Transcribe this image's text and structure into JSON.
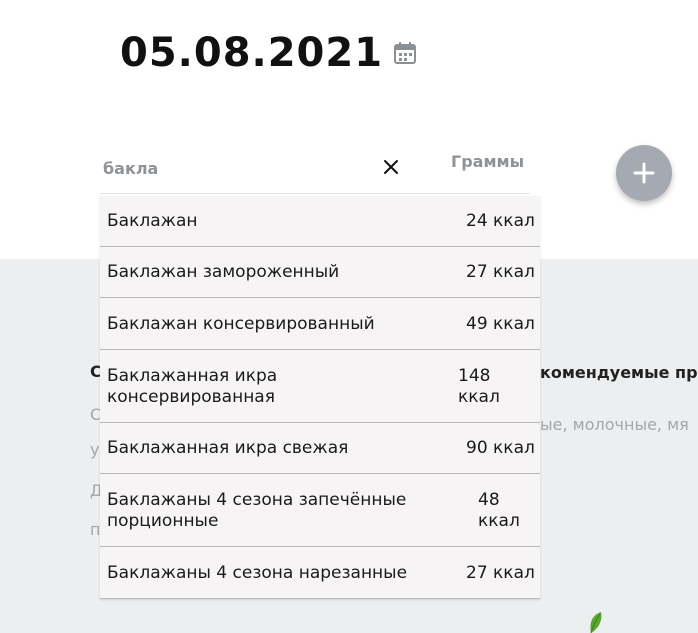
{
  "date": {
    "value": "05.08.2021"
  },
  "search": {
    "value": "бакла"
  },
  "columns": {
    "grams_label": "Граммы"
  },
  "background": {
    "heading_left_fragment": "С",
    "heading_right_fragment": "комендуемые пр",
    "text_right_fragment": "ые, молочные, мя",
    "line_fragments": [
      "С",
      "у",
      "Д",
      "п"
    ]
  },
  "suggestions": [
    {
      "name": "Баклажан",
      "kcal": "24 ккал"
    },
    {
      "name": "Баклажан замороженный",
      "kcal": "27 ккал"
    },
    {
      "name": "Баклажан консервированный",
      "kcal": "49 ккал"
    },
    {
      "name_line1": "Баклажанная икра",
      "name_line2": "консервированная",
      "kcal_line1": "148",
      "kcal_line2": "ккал"
    },
    {
      "name": "Баклажанная икра свежая",
      "kcal": "90 ккал"
    },
    {
      "name_line1": "Баклажаны 4 сезона запечённые",
      "name_line2": "порционные",
      "kcal_line1": "48",
      "kcal_line2": "ккал"
    },
    {
      "name": "Баклажаны 4 сезона нарезанные",
      "kcal": "27 ккал"
    }
  ],
  "icons": {
    "calendar": "calendar-icon",
    "clear": "close-icon",
    "add": "plus-icon",
    "leaf": "leaf-icon"
  }
}
